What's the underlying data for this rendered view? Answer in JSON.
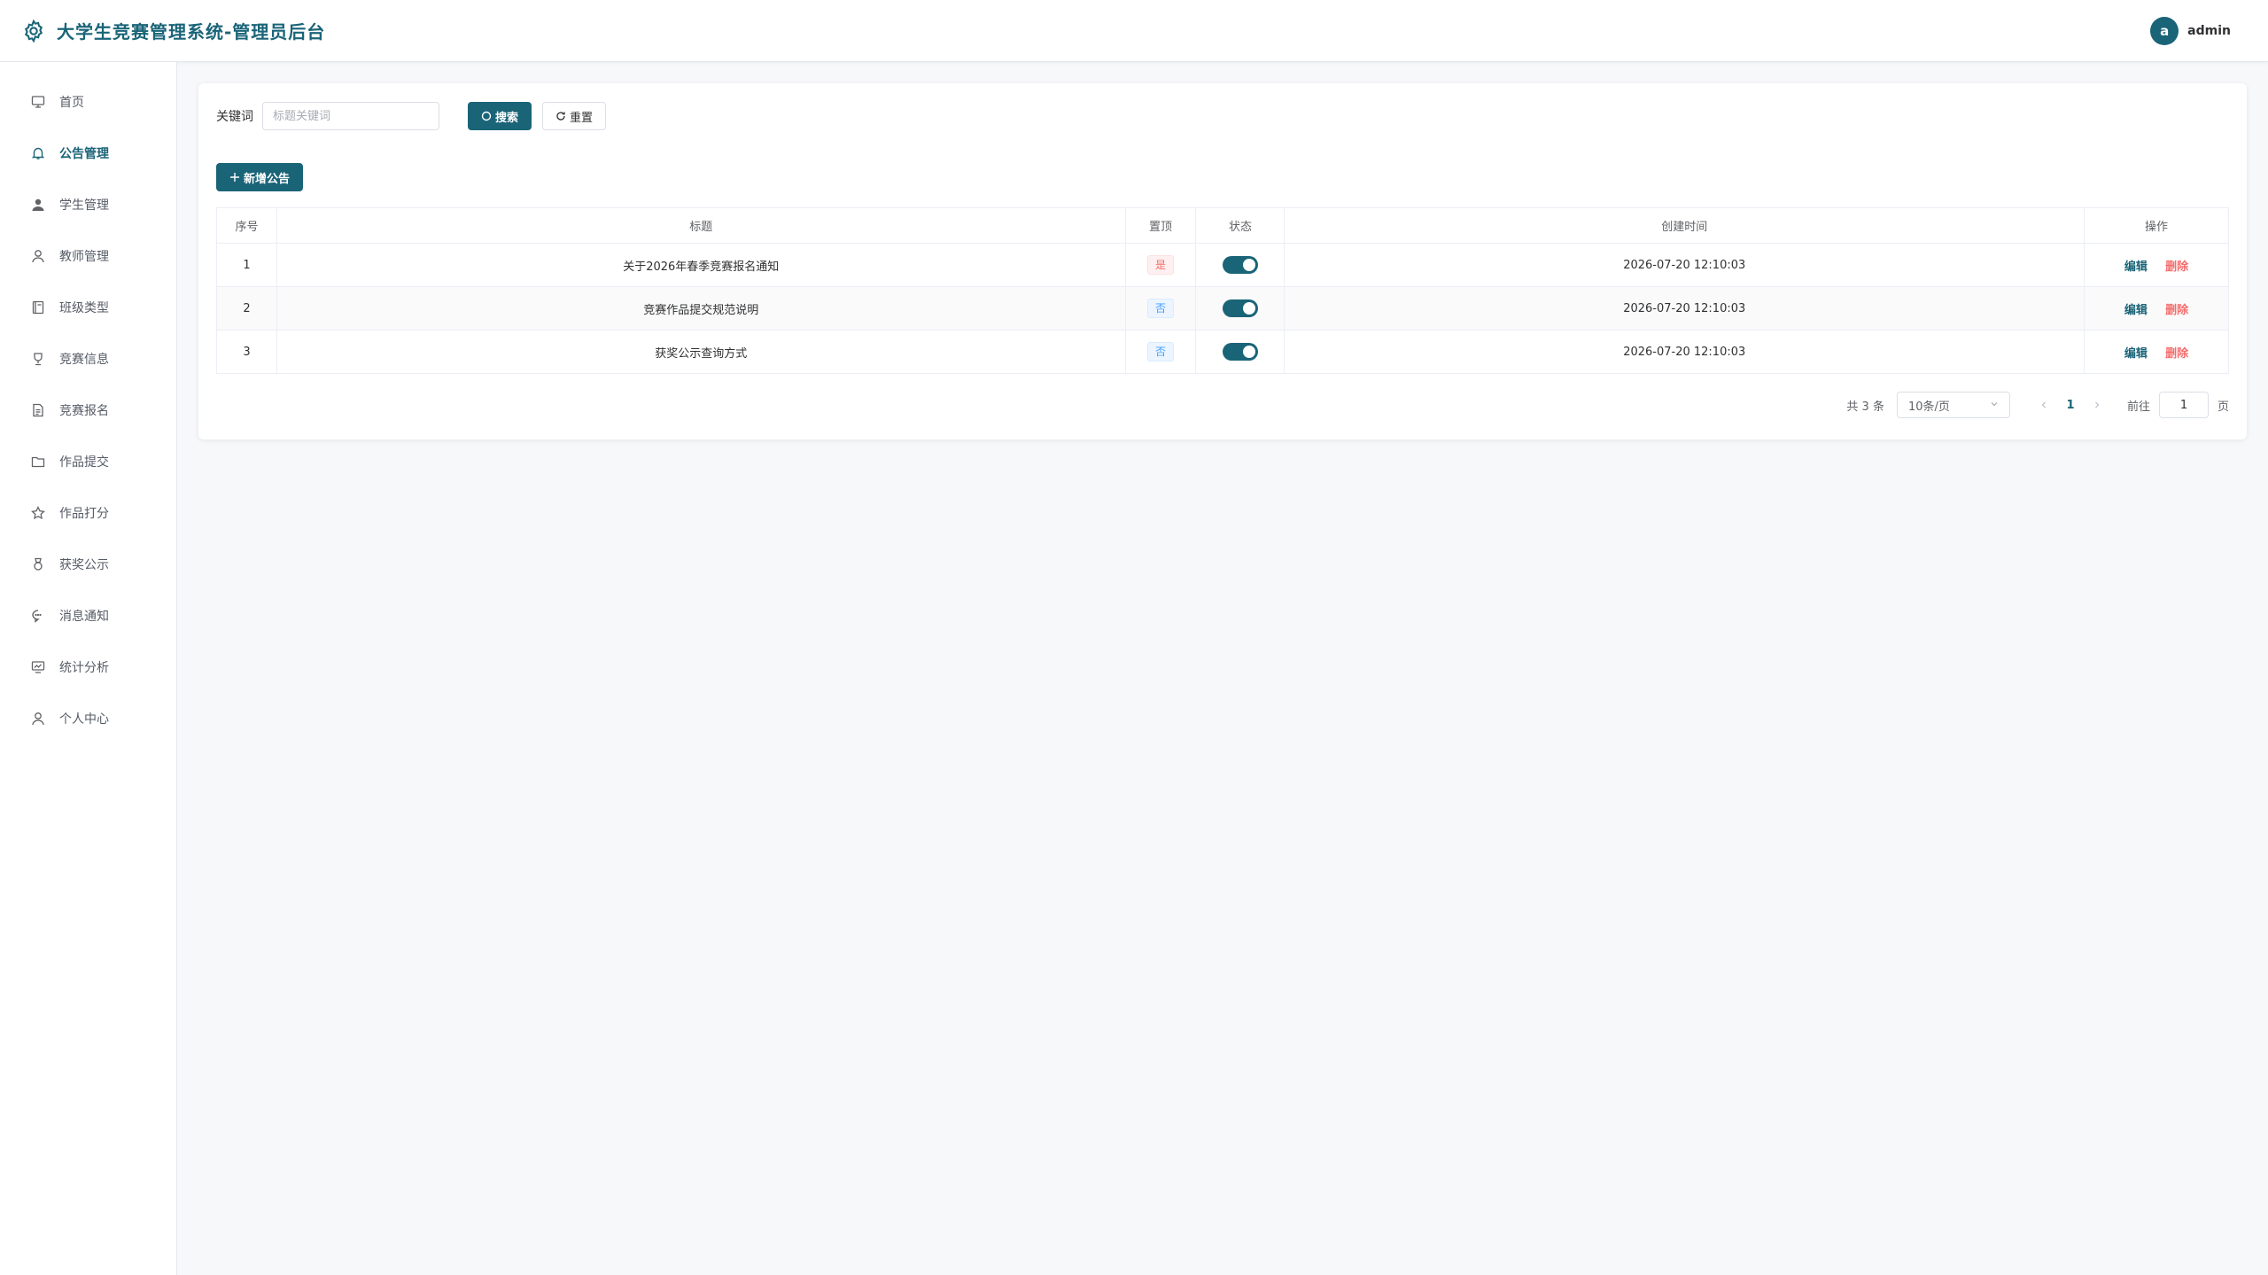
{
  "header": {
    "title": "大学生竞赛管理系统-管理员后台",
    "user": {
      "avatar_letter": "a",
      "name": "admin"
    }
  },
  "sidebar": {
    "items": [
      {
        "label": "首页",
        "icon": "monitor-icon",
        "active": false
      },
      {
        "label": "公告管理",
        "icon": "bell-icon",
        "active": true
      },
      {
        "label": "学生管理",
        "icon": "user-filled-icon",
        "active": false
      },
      {
        "label": "教师管理",
        "icon": "user-icon",
        "active": false
      },
      {
        "label": "班级类型",
        "icon": "notebook-icon",
        "active": false
      },
      {
        "label": "竞赛信息",
        "icon": "trophy-icon",
        "active": false
      },
      {
        "label": "竞赛报名",
        "icon": "document-icon",
        "active": false
      },
      {
        "label": "作品提交",
        "icon": "folder-icon",
        "active": false
      },
      {
        "label": "作品打分",
        "icon": "star-icon",
        "active": false
      },
      {
        "label": "获奖公示",
        "icon": "medal-icon",
        "active": false
      },
      {
        "label": "消息通知",
        "icon": "chat-icon",
        "active": false
      },
      {
        "label": "统计分析",
        "icon": "chart-icon",
        "active": false
      },
      {
        "label": "个人中心",
        "icon": "user-icon",
        "active": false
      }
    ]
  },
  "search": {
    "label": "关键词",
    "value": "",
    "placeholder": "标题关键词",
    "search_label": "搜索",
    "reset_label": "重置"
  },
  "actions": {
    "add_label": "新增公告"
  },
  "table": {
    "columns": [
      "序号",
      "标题",
      "置顶",
      "状态",
      "创建时间",
      "操作"
    ],
    "rows": [
      {
        "index": "1",
        "title": "关于2026年春季竞赛报名通知",
        "pinned": "是",
        "pinned_state": "yes",
        "status_on": true,
        "created": "2026-07-20 12:10:03"
      },
      {
        "index": "2",
        "title": "竞赛作品提交规范说明",
        "pinned": "否",
        "pinned_state": "no",
        "status_on": true,
        "created": "2026-07-20 12:10:03"
      },
      {
        "index": "3",
        "title": "获奖公示查询方式",
        "pinned": "否",
        "pinned_state": "no",
        "status_on": true,
        "created": "2026-07-20 12:10:03"
      }
    ],
    "edit_label": "编辑",
    "delete_label": "删除"
  },
  "pagination": {
    "total_text": "共 3 条",
    "page_size": "10条/页",
    "current_page": "1",
    "goto_label": "前往",
    "goto_value": "1",
    "goto_suffix": "页"
  },
  "colors": {
    "primary": "#1a6478",
    "danger": "#f56c6c",
    "info": "#409eff"
  }
}
